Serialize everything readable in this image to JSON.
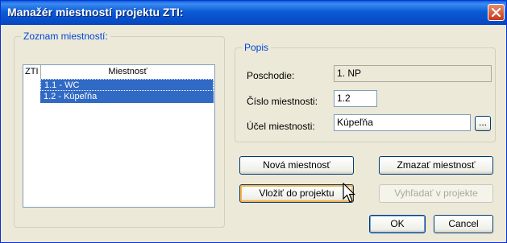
{
  "window": {
    "title": "Manažér miestností projektu ZTI:"
  },
  "room_list": {
    "group_label": "Zoznam miestností:",
    "columns": [
      "ZTI",
      "Miestnosť"
    ],
    "rows": [
      "1.1 - WC",
      "1.2 - Kúpeľňa"
    ]
  },
  "description": {
    "group_label": "Popis",
    "floor_label": "Poschodie:",
    "floor_value": "1. NP",
    "room_number_label": "Číslo miestnosti:",
    "room_number_value": "1.2",
    "purpose_label": "Účel miestnosti:",
    "purpose_value": "Kúpeľňa",
    "browse_label": "..."
  },
  "buttons": {
    "new_room": "Nová miestnosť",
    "delete_room": "Zmazať miestnosť",
    "insert_into_project": "Vložiť do projektu",
    "search_in_project": "Vyhľadať v projekte",
    "ok": "OK",
    "cancel": "Cancel"
  }
}
